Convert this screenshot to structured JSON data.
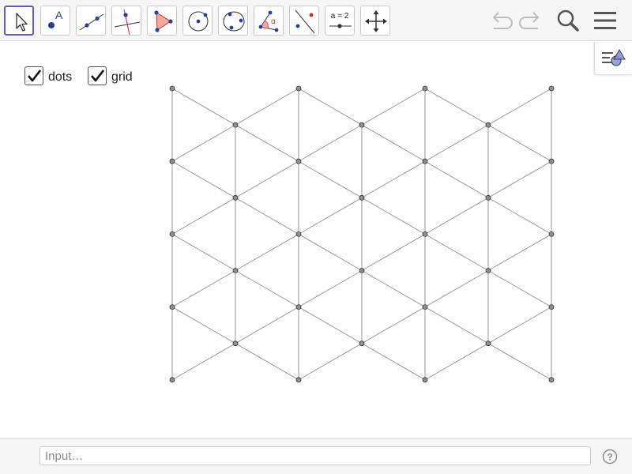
{
  "toolbar": {
    "tools": [
      {
        "name": "move-tool",
        "icon": "arrow-pointer-icon",
        "selected": true
      },
      {
        "name": "point-tool",
        "icon": "point-icon",
        "label": "A"
      },
      {
        "name": "line-tool",
        "icon": "line-through-points-icon"
      },
      {
        "name": "perpendicular-line-tool",
        "icon": "perpendicular-line-icon"
      },
      {
        "name": "polygon-tool",
        "icon": "polygon-icon"
      },
      {
        "name": "circle-center-point-tool",
        "icon": "circle-center-point-icon"
      },
      {
        "name": "circle-three-points-tool",
        "icon": "circle-three-points-icon"
      },
      {
        "name": "angle-tool",
        "icon": "angle-icon",
        "label": "α"
      },
      {
        "name": "reflect-about-line-tool",
        "icon": "reflect-icon"
      },
      {
        "name": "slider-tool",
        "icon": "slider-icon",
        "label": "a = 2"
      },
      {
        "name": "move-graphics-view-tool",
        "icon": "move-view-icon"
      }
    ],
    "undo_icon": "undo-icon",
    "redo_icon": "redo-icon",
    "search_icon": "search-icon",
    "menu_icon": "hamburger-menu-icon"
  },
  "checkboxes": [
    {
      "label": "dots",
      "checked": true
    },
    {
      "label": "grid",
      "checked": true
    }
  ],
  "input_bar": {
    "placeholder": "Input…"
  },
  "help_icon": "help-icon",
  "colors": {
    "accent": "#6557d2",
    "point_fill": "#8f8f8f",
    "grid_line": "#9a9a9a",
    "toolbar_bg": "#f6f6f6"
  }
}
